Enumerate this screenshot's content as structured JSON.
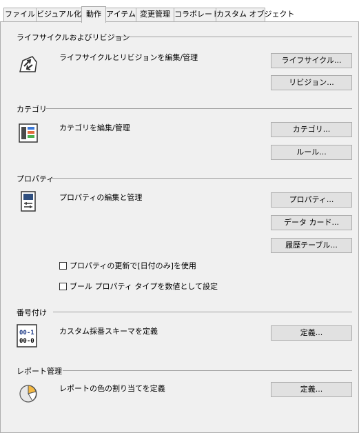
{
  "tabs": [
    "ファイル",
    "ビジュアル化",
    "動作",
    "アイテム",
    "変更管理",
    "コラボレート",
    "カスタム オブジェクト"
  ],
  "active_tab": "動作",
  "lifecycle": {
    "title": "ライフサイクルおよびリビジョン",
    "icon": "lifecycle-edit-icon",
    "description": "ライフサイクルとリビジョンを編集/管理",
    "lifecycle_button": "ライフサイクル...",
    "revision_button": "リビジョン..."
  },
  "category": {
    "title": "カテゴリ",
    "icon": "category-icon",
    "description": "カテゴリを編集/管理",
    "category_button": "カテゴリ...",
    "rule_button": "ルール..."
  },
  "properties": {
    "title": "プロパティ",
    "icon": "property-icon",
    "description": "プロパティの編集と管理",
    "property_button": "プロパティ...",
    "datacard_button": "データ カード...",
    "history_button": "履歴テーブル...",
    "update_date_only_label": "プロパティの更新で[日付のみ]を使用",
    "update_date_only_checked": false,
    "bool_numeric_label": "ブール プロパティ タイプを数値として設定",
    "bool_numeric_checked": false
  },
  "numbering": {
    "title": "番号付け",
    "icon": "numbering-scheme-icon",
    "icon_text_top": "00-1",
    "icon_text_bottom": "00-0",
    "description": "カスタム採番スキーマを定義",
    "define_button": "定義..."
  },
  "report": {
    "title": "レポート管理",
    "icon": "pie-chart-icon",
    "description": "レポートの色の割り当てを定義",
    "define_button": "定義..."
  }
}
